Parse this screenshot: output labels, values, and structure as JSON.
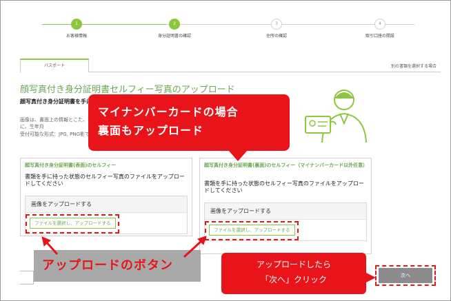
{
  "stepper": {
    "steps": [
      {
        "num": "1",
        "label": "お客様情報",
        "state": "done"
      },
      {
        "num": "2",
        "label": "身分証明書の確認",
        "state": "done"
      },
      {
        "num": "3",
        "label": "住所の確認",
        "state": "todo"
      },
      {
        "num": "4",
        "label": "取引口座の開設",
        "state": "todo"
      }
    ]
  },
  "tabs": {
    "active_label": "パスポート",
    "other_doc_link": "別の書類を選択する場合"
  },
  "section": {
    "title": "顔写真付き身分証明書セルフィー写真のアップロード",
    "desc_bold": "顔写真付き身分証明書を手にださい",
    "desc_text": "画像は、書面上の情報とこた、書類の裏面に、生年月",
    "formats": "受付可能な形式：JPG, PNG影できます。"
  },
  "callouts": {
    "main_line1": "マイナンバーカードの場合",
    "main_line2": "裏面もアップロード",
    "button_label": "アップロードのボタン",
    "next_line1": "アップロードしたら",
    "next_line2": "「次へ」クリック"
  },
  "cards": [
    {
      "title": "顔写真付き身分証明書(表面)のセルフィー",
      "text": "書類を手に持った状態のセルフィー写真のファイルをアップロードしてください",
      "upload_head": "画像をアップロードする",
      "button": "ファイルを選択し、アップロードする"
    },
    {
      "title": "顔写真付き身分証明書(裏面)のセルフィー（マイナンバーカード以外任意）",
      "text": "書類を手に持った状態のセルフィー写真のファイルをアップロードしてください",
      "upload_head": "画像をアップロードする",
      "button": "ファイルを選択し、アップロードする"
    }
  ],
  "footer": {
    "next_button": "次へ"
  },
  "colors": {
    "accent_green": "#8dc63f",
    "callout_red": "#e8141a",
    "next_gray": "#8c8c8c"
  }
}
